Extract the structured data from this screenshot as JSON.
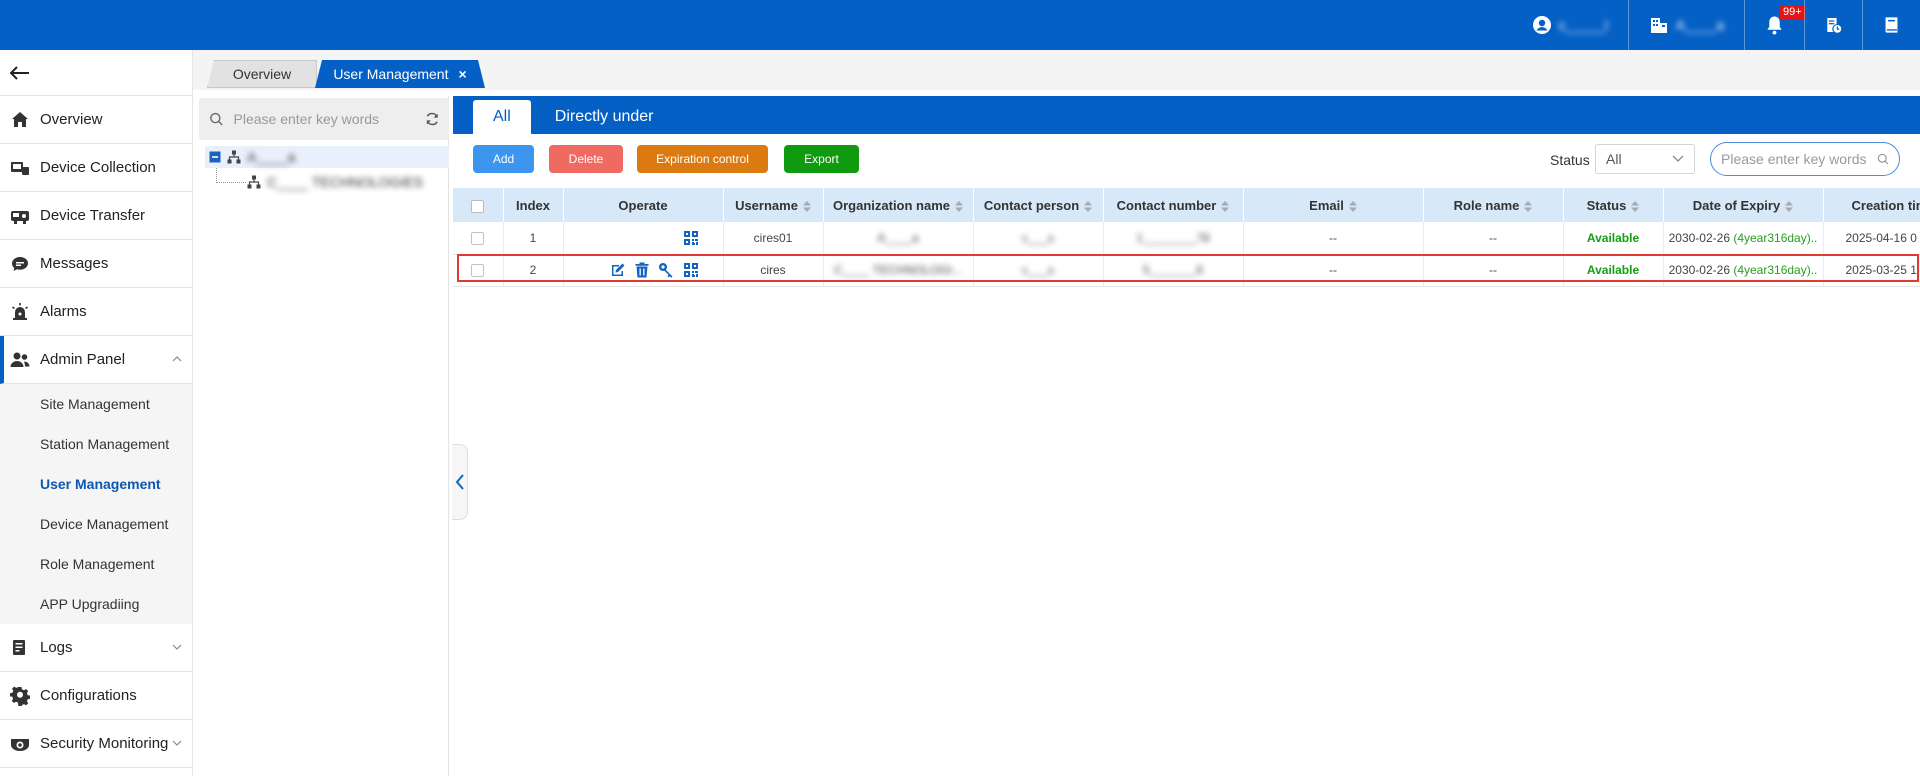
{
  "topbar": {
    "user_name": "c_____l",
    "org_name": "A____a",
    "notification_badge": "99+",
    "colors": {
      "bar": "#0560c6"
    }
  },
  "sidebar": {
    "items": [
      {
        "label": "Overview",
        "icon": "home-icon"
      },
      {
        "label": "Device Collection",
        "icon": "device-collection-icon"
      },
      {
        "label": "Device Transfer",
        "icon": "device-transfer-icon"
      },
      {
        "label": "Messages",
        "icon": "chat-icon"
      },
      {
        "label": "Alarms",
        "icon": "alarm-icon"
      },
      {
        "label": "Admin Panel",
        "icon": "users-icon"
      }
    ],
    "admin_submenu": [
      "Site Management",
      "Station Management",
      "User Management",
      "Device Management",
      "Role Management",
      "APP Upgradiing"
    ],
    "bottom_items": [
      {
        "label": "Logs",
        "icon": "logs-icon"
      },
      {
        "label": "Configurations",
        "icon": "gear-icon"
      },
      {
        "label": "Security Monitoring",
        "icon": "camera-icon"
      }
    ]
  },
  "tabs": {
    "overview": "Overview",
    "user_management": "User Management",
    "close": "×"
  },
  "tree": {
    "search_placeholder": "Please enter key words",
    "root": "A____a",
    "child": "C____ TECHNOLOGIES"
  },
  "main": {
    "subtabs": {
      "all": "All",
      "direct": "Directly under"
    },
    "buttons": {
      "add": "Add",
      "delete": "Delete",
      "expiration": "Expiration control",
      "export": "Export"
    },
    "status_label": "Status",
    "status_value": "All",
    "search_placeholder": "Please enter key words"
  },
  "table": {
    "headers": {
      "index": "Index",
      "operate": "Operate",
      "username": "Username",
      "org": "Organization name",
      "contact": "Contact person",
      "phone": "Contact number",
      "email": "Email",
      "role": "Role name",
      "status": "Status",
      "expiry": "Date of Expiry",
      "created": "Creation time"
    },
    "rows": [
      {
        "index": "1",
        "username": "cires01",
        "org": "A____a",
        "contact": "c___s",
        "phone": "1________78",
        "email": "--",
        "role": "--",
        "status": "Available",
        "expiry_date": "2030-02-26",
        "expiry_extra": " (4year316day)..",
        "created": "2025-04-16 0"
      },
      {
        "index": "2",
        "username": "cires",
        "org": "C____ TECHNOLOGI...",
        "contact": "c___s",
        "phone": "5_______6",
        "email": "--",
        "role": "--",
        "status": "Available",
        "expiry_date": "2030-02-26",
        "expiry_extra": " (4year316day)..",
        "created": "2025-03-25 1"
      }
    ]
  }
}
